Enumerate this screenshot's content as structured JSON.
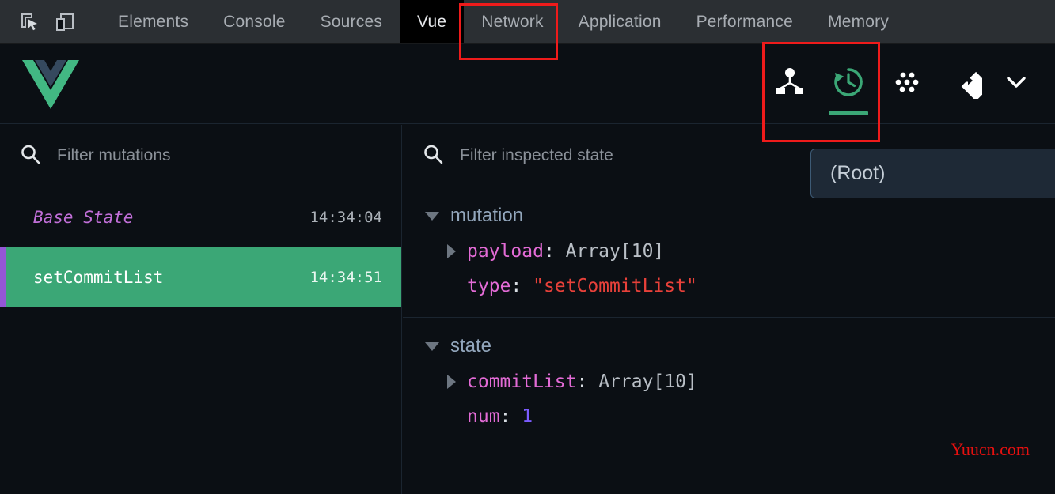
{
  "devtools": {
    "tools": [
      {
        "name": "inspect-element-icon",
        "label": "Inspect element"
      },
      {
        "name": "device-toolbar-icon",
        "label": "Toggle device toolbar"
      }
    ],
    "tabs": [
      {
        "label": "Elements",
        "selected": false
      },
      {
        "label": "Console",
        "selected": false
      },
      {
        "label": "Sources",
        "selected": false
      },
      {
        "label": "Vue",
        "selected": true
      },
      {
        "label": "Network",
        "selected": false
      },
      {
        "label": "Application",
        "selected": false
      },
      {
        "label": "Performance",
        "selected": false
      },
      {
        "label": "Memory",
        "selected": false
      }
    ]
  },
  "vue_header": {
    "logo": "vue-logo",
    "logo_colors": {
      "outer": "#42b883",
      "inner": "#35495e"
    },
    "buttons": [
      {
        "icon": "component-tree-icon",
        "label": "Components",
        "active": false
      },
      {
        "icon": "history-clock-icon",
        "label": "Vuex",
        "active": true
      },
      {
        "icon": "events-dots-icon",
        "label": "Events",
        "active": false
      },
      {
        "icon": "routing-diamond-icon",
        "label": "Routing",
        "active": false
      },
      {
        "icon": "chevron-down-icon",
        "label": "More",
        "active": false
      }
    ],
    "active_color": "#3ba776"
  },
  "root_select": {
    "value": "(Root)"
  },
  "mutations_panel": {
    "search": {
      "icon": "search-icon",
      "placeholder": "Filter mutations"
    },
    "rows": [
      {
        "label": "Base State",
        "time": "14:34:04",
        "base": true,
        "selected": false
      },
      {
        "label": "setCommitList",
        "time": "14:34:51",
        "base": false,
        "selected": true
      }
    ]
  },
  "inspector_panel": {
    "search": {
      "icon": "search-icon",
      "placeholder": "Filter inspected state"
    },
    "sections": [
      {
        "title": "mutation",
        "entries": [
          {
            "expandable": true,
            "key": "payload",
            "value": "Array[10]",
            "value_type": "gray"
          },
          {
            "expandable": false,
            "key": "type",
            "value": "\"setCommitList\"",
            "value_type": "string"
          }
        ]
      },
      {
        "title": "state",
        "entries": [
          {
            "expandable": true,
            "key": "commitList",
            "value": "Array[10]",
            "value_type": "gray"
          },
          {
            "expandable": false,
            "key": "num",
            "value": "1",
            "value_type": "num"
          }
        ]
      }
    ]
  },
  "annotations": {
    "color": "#ef1b1b",
    "boxes": [
      {
        "target": "vue-tab"
      },
      {
        "target": "vuex-history-button"
      }
    ]
  },
  "watermark": {
    "text": "Yuucn.com",
    "color": "#e8100f"
  }
}
